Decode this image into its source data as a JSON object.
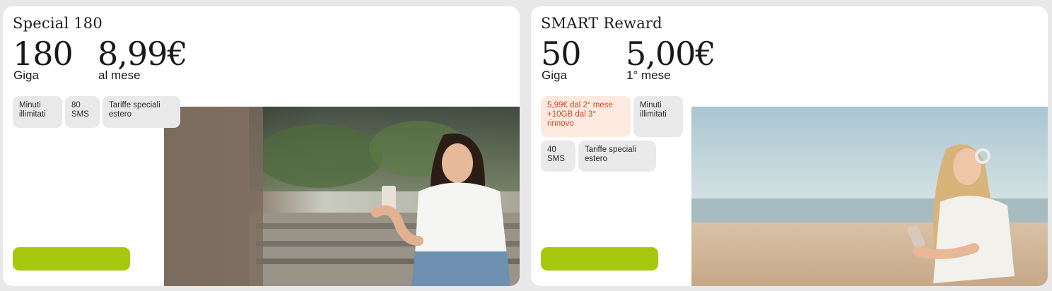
{
  "offers": [
    {
      "name": "Special 180",
      "data_amount": "180",
      "data_unit": "Giga",
      "price": "8,99€",
      "price_period": "al mese",
      "features": [
        "Minuti illimitati",
        "80 SMS",
        "Tariffe speciali estero"
      ],
      "cta_label": "",
      "cta_color": "#a8c70f"
    },
    {
      "name": "SMART Reward",
      "data_amount": "50",
      "data_unit": "Giga",
      "price": "5,00€",
      "price_period": "1° mese",
      "promo": "5,99€ dal 2° mese +10GB dal 3° rinnovo",
      "promo_color": "#c94a1e",
      "features": [
        "Minuti illimitati",
        "40 SMS",
        "Tariffe speciali estero"
      ],
      "cta_label": "",
      "cta_color": "#a8c70f"
    }
  ]
}
